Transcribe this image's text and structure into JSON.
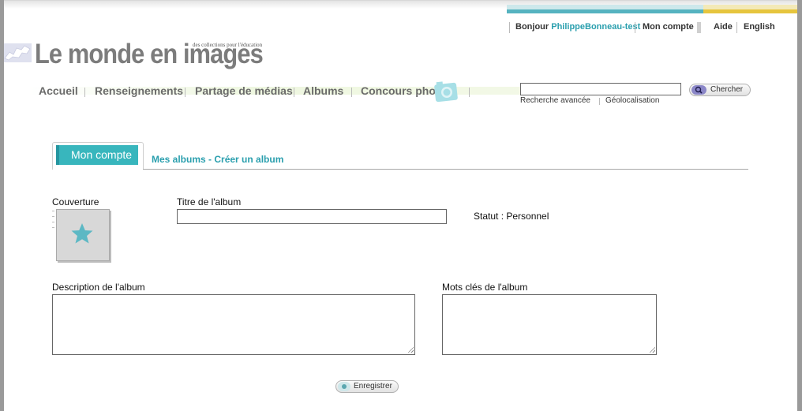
{
  "user_bar": {
    "greeting": "Bonjour",
    "username": "PhilippeBonneau-test",
    "account": "Mon compte",
    "help": "Aide",
    "language": "English"
  },
  "logo": {
    "title": "Le monde en images",
    "subtitle": "des collections pour l'éducation"
  },
  "nav": {
    "items": [
      "Accueil",
      "Renseignements",
      "Partage de médias",
      "Albums",
      "Concours photo"
    ]
  },
  "search": {
    "value": "",
    "button": "Chercher",
    "advanced": "Recherche avancée",
    "geo": "Géolocalisation"
  },
  "tabs": {
    "active": "Mon compte",
    "breadcrumb": "Mes albums - Créer un album"
  },
  "form": {
    "cover_label": "Couverture",
    "title_label": "Titre de l'album",
    "title_value": "",
    "status": "Statut : Personnel",
    "description_label": "Description de l'album",
    "description_value": "",
    "keywords_label": "Mots clés de l'album",
    "keywords_value": "",
    "save_button": "Enregistrer"
  },
  "colors": {
    "accent": "#38b6bd",
    "link": "#2a9fae",
    "nav_text": "#6b6b6b",
    "stripe_yellow": "#e6c53e"
  }
}
